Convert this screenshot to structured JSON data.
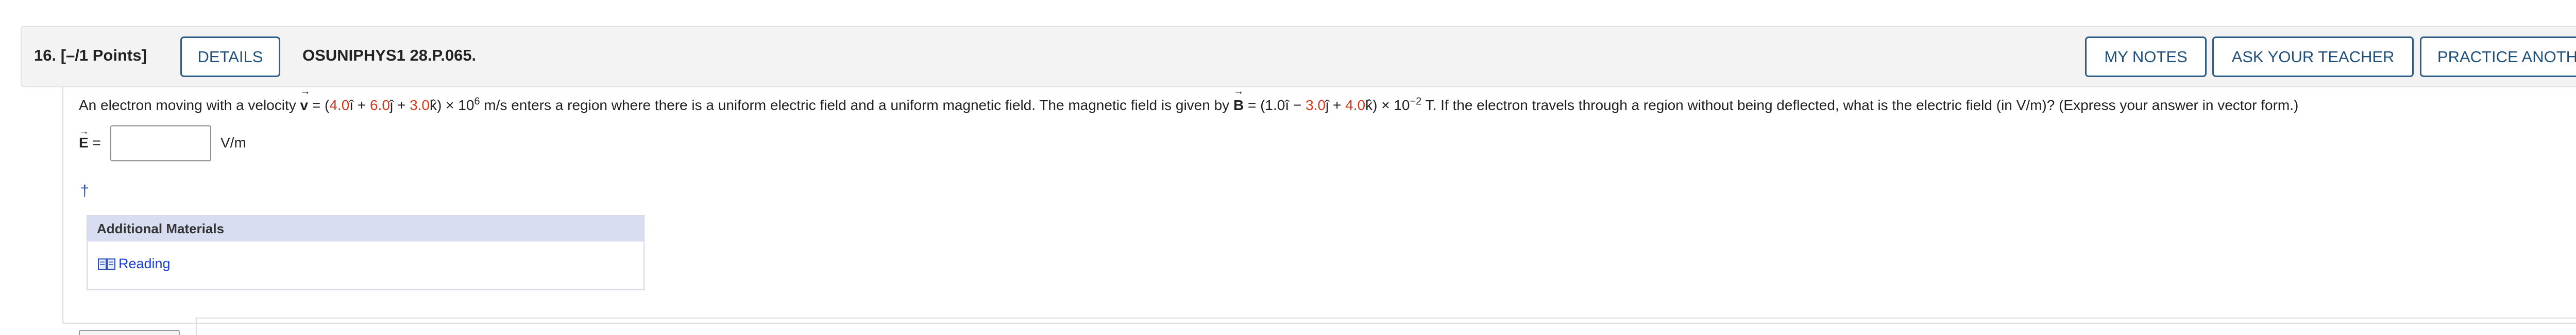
{
  "question": {
    "number_points": "16.  [–/1 Points]",
    "details_label": "DETAILS",
    "code": "OSUNIPHYS1 28.P.065."
  },
  "toolbar": {
    "my_notes_label": "MY NOTES",
    "ask_teacher_label": "ASK YOUR TEACHER",
    "practice_label": "PRACTICE ANOTHER"
  },
  "problem": {
    "intro": "An electron moving with a velocity ",
    "v_symbol": "v",
    "arrow": "→",
    "v_eq_open": " = (",
    "v_x": "4.0",
    "i_hat": "î",
    "plus": " + ",
    "v_y": "6.0",
    "j_hat": "ĵ",
    "v_z": "3.0",
    "k_hat": "k̂",
    "v_close": ") × 10",
    "v_exp": "6",
    "v_unit_text": " m/s enters a region where there is a uniform electric field and a uniform magnetic field. The magnetic field is given by ",
    "b_symbol": "B",
    "b_eq_open": " = (1.0",
    "minus": " − ",
    "b_y": "3.0",
    "b_z": "4.0",
    "b_close": ") × 10",
    "b_exp": "−2",
    "tail": " T. If the electron travels through a region without being deflected, what is the electric field (in V/m)? (Express your answer in vector form.)"
  },
  "answer": {
    "e_symbol": "E",
    "equals": " =",
    "value": "",
    "unit": "V/m"
  },
  "dagger": "†",
  "additional_materials": {
    "title": "Additional Materials",
    "reading_label": "Reading",
    "icon": "book-icon"
  },
  "colors": {
    "button_border": "#2e5d86",
    "red_values": "#d9361c",
    "link": "#1a3ed6",
    "materials_header": "#d9ddf1"
  }
}
